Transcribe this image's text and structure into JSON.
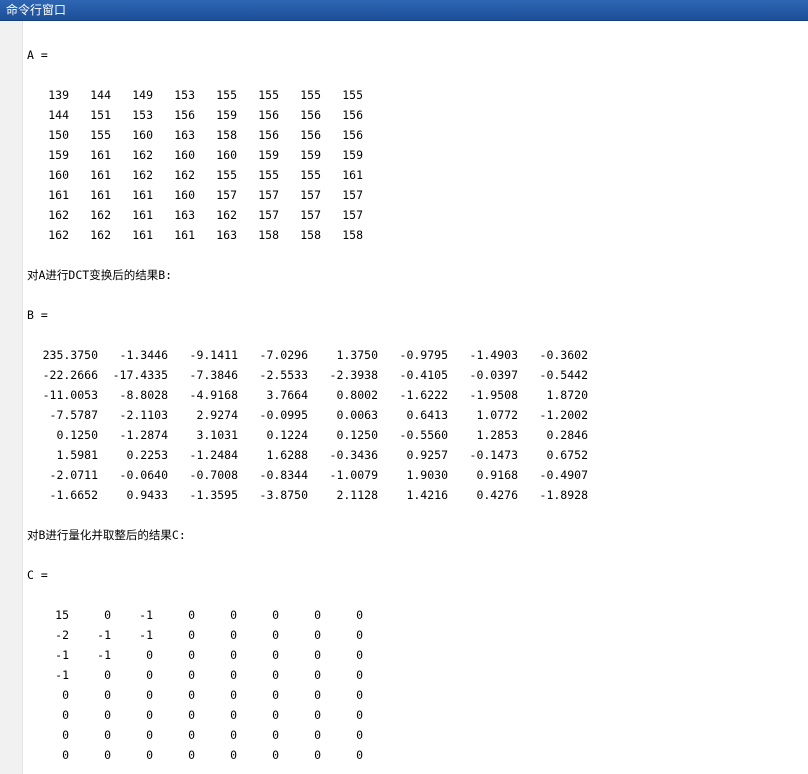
{
  "window": {
    "title": "命令行窗口"
  },
  "console": {
    "label_a": "A =",
    "label_b_caption": "对A进行DCT变换后的结果B:",
    "label_b": "B =",
    "label_c_caption": "对B进行量化并取整后的结果C:",
    "label_c": "C =",
    "matrix_a": [
      [
        "139",
        "144",
        "149",
        "153",
        "155",
        "155",
        "155",
        "155"
      ],
      [
        "144",
        "151",
        "153",
        "156",
        "159",
        "156",
        "156",
        "156"
      ],
      [
        "150",
        "155",
        "160",
        "163",
        "158",
        "156",
        "156",
        "156"
      ],
      [
        "159",
        "161",
        "162",
        "160",
        "160",
        "159",
        "159",
        "159"
      ],
      [
        "160",
        "161",
        "162",
        "162",
        "155",
        "155",
        "155",
        "161"
      ],
      [
        "161",
        "161",
        "161",
        "160",
        "157",
        "157",
        "157",
        "157"
      ],
      [
        "162",
        "162",
        "161",
        "163",
        "162",
        "157",
        "157",
        "157"
      ],
      [
        "162",
        "162",
        "161",
        "161",
        "163",
        "158",
        "158",
        "158"
      ]
    ],
    "matrix_b": [
      [
        "235.3750",
        "-1.3446",
        "-9.1411",
        "-7.0296",
        "1.3750",
        "-0.9795",
        "-1.4903",
        "-0.3602"
      ],
      [
        "-22.2666",
        "-17.4335",
        "-7.3846",
        "-2.5533",
        "-2.3938",
        "-0.4105",
        "-0.0397",
        "-0.5442"
      ],
      [
        "-11.0053",
        "-8.8028",
        "-4.9168",
        "3.7664",
        "0.8002",
        "-1.6222",
        "-1.9508",
        "1.8720"
      ],
      [
        "-7.5787",
        "-2.1103",
        "2.9274",
        "-0.0995",
        "0.0063",
        "0.6413",
        "1.0772",
        "-1.2002"
      ],
      [
        "0.1250",
        "-1.2874",
        "3.1031",
        "0.1224",
        "0.1250",
        "-0.5560",
        "1.2853",
        "0.2846"
      ],
      [
        "1.5981",
        "0.2253",
        "-1.2484",
        "1.6288",
        "-0.3436",
        "0.9257",
        "-0.1473",
        "0.6752"
      ],
      [
        "-2.0711",
        "-0.0640",
        "-0.7008",
        "-0.8344",
        "-1.0079",
        "1.9030",
        "0.9168",
        "-0.4907"
      ],
      [
        "-1.6652",
        "0.9433",
        "-1.3595",
        "-3.8750",
        "2.1128",
        "1.4216",
        "0.4276",
        "-1.8928"
      ]
    ],
    "matrix_c": [
      [
        "15",
        "0",
        "-1",
        "0",
        "0",
        "0",
        "0",
        "0"
      ],
      [
        "-2",
        "-1",
        "-1",
        "0",
        "0",
        "0",
        "0",
        "0"
      ],
      [
        "-1",
        "-1",
        "0",
        "0",
        "0",
        "0",
        "0",
        "0"
      ],
      [
        "-1",
        "0",
        "0",
        "0",
        "0",
        "0",
        "0",
        "0"
      ],
      [
        "0",
        "0",
        "0",
        "0",
        "0",
        "0",
        "0",
        "0"
      ],
      [
        "0",
        "0",
        "0",
        "0",
        "0",
        "0",
        "0",
        "0"
      ],
      [
        "0",
        "0",
        "0",
        "0",
        "0",
        "0",
        "0",
        "0"
      ],
      [
        "0",
        "0",
        "0",
        "0",
        "0",
        "0",
        "0",
        "0"
      ]
    ]
  }
}
